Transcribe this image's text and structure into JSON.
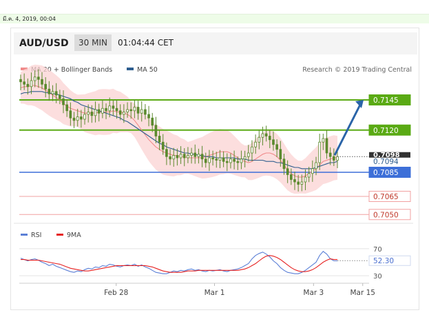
{
  "date_text": "มี.ค. 4, 2019, 00:04",
  "header": {
    "symbol": "AUD/USD",
    "interval": "30 MIN",
    "time": "01:04:44 CET"
  },
  "legend": [
    {
      "label": "MA 20 + Bollinger Bands",
      "color": "#f08a8a"
    },
    {
      "label": "MA 50",
      "color": "#2e5d8e"
    }
  ],
  "copyright": "Research © 2019 Trading Central",
  "colors": {
    "candle": "#5b8a2e",
    "resistance": "#5aaa14",
    "pivot": "#3d6fd8",
    "support": "#f2a0a0",
    "price_tag": "#333333",
    "arrow": "#2a64a8"
  },
  "chart_data": [
    {
      "type": "candlestick",
      "x_ticks": [
        "Feb 28",
        "Mar 1",
        "Mar 3",
        "Mar 15"
      ],
      "ylim": [
        0.7045,
        0.7165
      ],
      "last_price": "0.7098",
      "levels": [
        {
          "value": 0.7145,
          "label": "0.7145",
          "kind": "resistance"
        },
        {
          "value": 0.712,
          "label": "0.7120",
          "kind": "resistance"
        },
        {
          "value": 0.7094,
          "label": "0.7094",
          "kind": "ma"
        },
        {
          "value": 0.7085,
          "label": "0.7085",
          "kind": "pivot"
        },
        {
          "value": 0.7065,
          "label": "0.7065",
          "kind": "support"
        },
        {
          "value": 0.705,
          "label": "0.7050",
          "kind": "support"
        }
      ],
      "close": [
        0.716,
        0.7158,
        0.7156,
        0.7161,
        0.7164,
        0.7162,
        0.7158,
        0.7154,
        0.715,
        0.7152,
        0.7149,
        0.7146,
        0.7141,
        0.7136,
        0.713,
        0.7128,
        0.7131,
        0.7129,
        0.7133,
        0.7135,
        0.7132,
        0.7137,
        0.7134,
        0.7138,
        0.7136,
        0.714,
        0.7138,
        0.7136,
        0.7133,
        0.7135,
        0.7137,
        0.7136,
        0.7139,
        0.7134,
        0.7137,
        0.7133,
        0.713,
        0.7124,
        0.7115,
        0.711,
        0.7104,
        0.7098,
        0.7096,
        0.7099,
        0.7097,
        0.71,
        0.7097,
        0.7099,
        0.7101,
        0.7098,
        0.71,
        0.7096,
        0.7093,
        0.7097,
        0.7096,
        0.7095,
        0.7097,
        0.7094,
        0.7093,
        0.7096,
        0.7094,
        0.7093,
        0.7096,
        0.7098,
        0.7101,
        0.7106,
        0.711,
        0.7114,
        0.7117,
        0.7115,
        0.7112,
        0.7108,
        0.7104,
        0.7096,
        0.7088,
        0.7083,
        0.7079,
        0.7077,
        0.7075,
        0.7077,
        0.7081,
        0.7084,
        0.7088,
        0.7093,
        0.711,
        0.7113,
        0.7101,
        0.7098,
        0.7095,
        0.7098
      ],
      "ma20": [
        0.7155,
        0.7156,
        0.7156,
        0.7157,
        0.7157,
        0.7156,
        0.7155,
        0.7153,
        0.7151,
        0.7149,
        0.7147,
        0.7145,
        0.7142,
        0.714,
        0.7138,
        0.7137,
        0.7136,
        0.7135,
        0.7134,
        0.7134,
        0.7134,
        0.7134,
        0.7135,
        0.7135,
        0.7135,
        0.7135,
        0.7136,
        0.7135,
        0.7135,
        0.7134,
        0.7133,
        0.7131,
        0.7128,
        0.7124,
        0.712,
        0.7116,
        0.7112,
        0.7109,
        0.7106,
        0.7104,
        0.7102,
        0.7101,
        0.71,
        0.7099,
        0.7099,
        0.7098,
        0.7098,
        0.7097,
        0.7097,
        0.7097,
        0.7097,
        0.7097,
        0.7098,
        0.7099,
        0.71,
        0.7101,
        0.7102,
        0.7102,
        0.7102,
        0.7101,
        0.7099,
        0.7097,
        0.7095,
        0.7094,
        0.7093,
        0.7094,
        0.7096,
        0.7098,
        0.71,
        0.7101,
        0.7101,
        0.71,
        0.7098,
        0.7095,
        0.7091,
        0.7087,
        0.7084,
        0.7082,
        0.7081,
        0.7081,
        0.7082,
        0.7084,
        0.7086,
        0.7088,
        0.7091,
        0.7094,
        0.7095,
        0.7096,
        0.7097,
        0.7097
      ],
      "ma50": [
        0.715,
        0.7151,
        0.7151,
        0.7152,
        0.7152,
        0.7152,
        0.7152,
        0.7151,
        0.7151,
        0.715,
        0.715,
        0.7149,
        0.7148,
        0.7147,
        0.7146,
        0.7144,
        0.7143,
        0.7141,
        0.714,
        0.7139,
        0.7138,
        0.7137,
        0.7136,
        0.7135,
        0.7134,
        0.7133,
        0.7132,
        0.7131,
        0.713,
        0.7128,
        0.7127,
        0.7125,
        0.7123,
        0.7121,
        0.7119,
        0.7117,
        0.7115,
        0.7113,
        0.7111,
        0.7109,
        0.7108,
        0.7106,
        0.7105,
        0.7104,
        0.7103,
        0.7102,
        0.7101,
        0.7101,
        0.71,
        0.71,
        0.7099,
        0.7099,
        0.7098,
        0.7098,
        0.7098,
        0.7097,
        0.7097,
        0.7097,
        0.7097,
        0.7097,
        0.7097,
        0.7096,
        0.7096,
        0.7096,
        0.7095,
        0.7095,
        0.7095,
        0.7095,
        0.7095,
        0.7094,
        0.7094,
        0.7094,
        0.7093,
        0.7093,
        0.7092,
        0.7091,
        0.709,
        0.7089,
        0.7089,
        0.7088,
        0.7088,
        0.7088,
        0.7088,
        0.7089,
        0.709,
        0.7091,
        0.7092,
        0.7093,
        0.7093,
        0.7094
      ],
      "forecast_arrow": {
        "from": 0.7098,
        "to": 0.7145
      }
    },
    {
      "type": "line",
      "title": "RSI",
      "legend": [
        "RSI",
        "9MA"
      ],
      "ylim": [
        25,
        75
      ],
      "y_ticks": [
        70,
        30
      ],
      "current_value": "52.30",
      "series": [
        {
          "name": "RSI",
          "color": "#5b7fd6",
          "values": [
            56,
            54,
            52,
            54,
            55,
            53,
            50,
            48,
            45,
            47,
            44,
            42,
            40,
            38,
            36,
            35,
            37,
            36,
            39,
            41,
            40,
            43,
            42,
            45,
            44,
            47,
            46,
            44,
            43,
            45,
            46,
            45,
            47,
            44,
            46,
            43,
            41,
            38,
            35,
            34,
            33,
            33,
            35,
            37,
            36,
            38,
            37,
            39,
            40,
            38,
            39,
            37,
            36,
            38,
            37,
            38,
            39,
            37,
            36,
            38,
            39,
            40,
            42,
            45,
            48,
            55,
            60,
            63,
            65,
            62,
            58,
            52,
            48,
            42,
            38,
            35,
            34,
            33,
            33,
            35,
            38,
            42,
            46,
            50,
            60,
            66,
            62,
            55,
            52,
            52
          ]
        },
        {
          "name": "9MA",
          "color": "#e62020",
          "values": [
            54,
            54,
            53,
            53,
            53,
            53,
            52,
            51,
            50,
            49,
            48,
            47,
            45,
            43,
            41,
            40,
            39,
            38,
            37,
            37,
            38,
            39,
            40,
            41,
            42,
            43,
            44,
            45,
            45,
            45,
            45,
            45,
            45,
            45,
            45,
            45,
            44,
            43,
            41,
            39,
            37,
            36,
            35,
            35,
            35,
            35,
            36,
            37,
            37,
            37,
            38,
            38,
            38,
            38,
            38,
            38,
            38,
            38,
            38,
            38,
            38,
            38,
            39,
            40,
            42,
            45,
            48,
            52,
            56,
            59,
            60,
            59,
            57,
            54,
            50,
            46,
            42,
            39,
            37,
            36,
            36,
            37,
            39,
            42,
            46,
            50,
            53,
            55,
            54,
            54
          ]
        }
      ]
    }
  ]
}
